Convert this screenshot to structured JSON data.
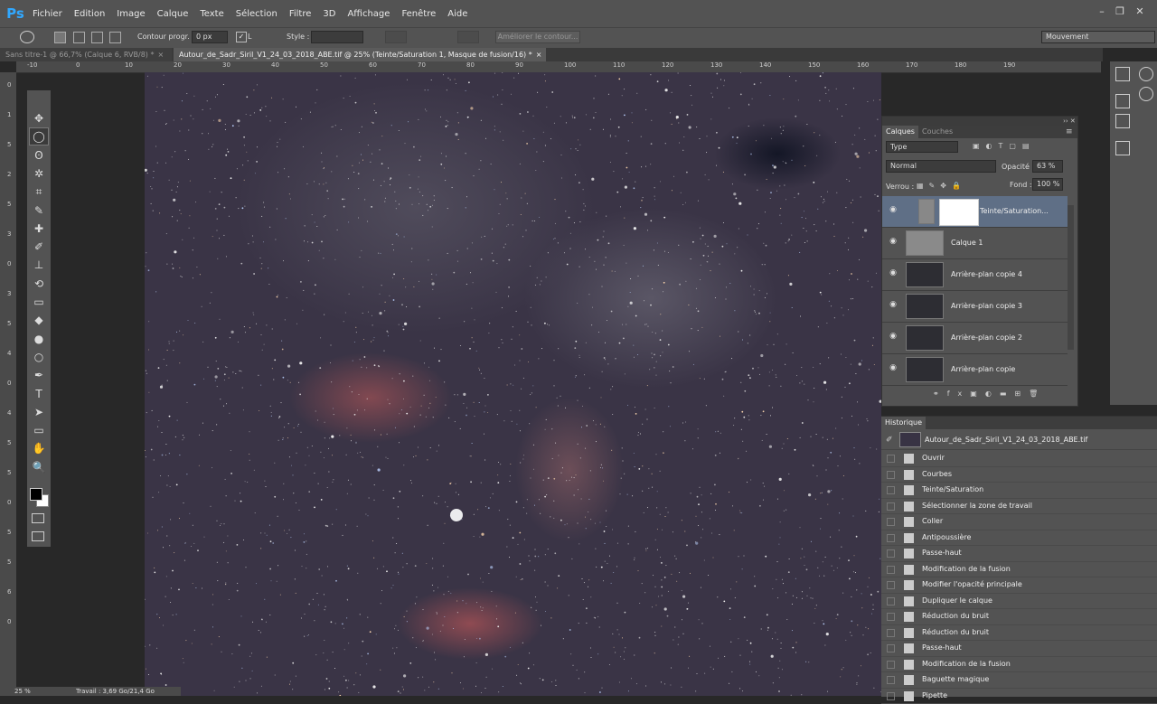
{
  "app": {
    "logo": "Ps"
  },
  "menu": [
    "Fichier",
    "Edition",
    "Image",
    "Calque",
    "Texte",
    "Sélection",
    "Filtre",
    "3D",
    "Affichage",
    "Fenêtre",
    "Aide"
  ],
  "window_controls": [
    "–",
    "❐",
    "✕"
  ],
  "options_bar": {
    "feather_label": "Contour progr. :",
    "feather_value": "0 px",
    "antialias_label": "L",
    "style_label": "Style :",
    "refine_edge_button": "Améliorer le contour...",
    "workspace_value": "Mouvement"
  },
  "tabs": [
    {
      "label": "Sans titre-1 @ 66,7% (Calque 6, RVB/8) *",
      "close": "×"
    },
    {
      "label": "Autour_de_Sadr_Siril_V1_24_03_2018_ABE.tif @ 25% (Teinte/Saturation 1, Masque de fusion/16) *",
      "close": "×"
    }
  ],
  "ruler_h": [
    "-10",
    "0",
    "10",
    "20",
    "30",
    "40",
    "50",
    "60",
    "70",
    "80",
    "90",
    "100",
    "110",
    "120",
    "130",
    "140",
    "150",
    "160",
    "170",
    "180",
    "190"
  ],
  "ruler_v": [
    "0",
    "1",
    "5",
    "2",
    "5",
    "3",
    "0",
    "3",
    "5",
    "4",
    "0",
    "4",
    "5",
    "5",
    "0",
    "5",
    "5",
    "6",
    "0"
  ],
  "toolbox": {
    "tools": [
      "move-tool-icon",
      "elliptical-marquee-icon",
      "lasso-icon",
      "magic-wand-icon",
      "crop-icon",
      "eyedropper-icon",
      "healing-brush-icon",
      "brush-icon",
      "clone-stamp-icon",
      "history-brush-icon",
      "eraser-icon",
      "paint-bucket-icon",
      "blur-icon",
      "dodge-icon",
      "pen-icon",
      "type-icon",
      "path-selection-icon",
      "rectangle-icon",
      "hand-icon",
      "zoom-icon"
    ],
    "glyphs": [
      "✥",
      "◯",
      "ʘ",
      "✲",
      "⌗",
      "✎",
      "✚",
      "✐",
      "⊥",
      "⟲",
      "▭",
      "◆",
      "●",
      "○",
      "✒",
      "T",
      "➤",
      "▭",
      "✋",
      "🔍"
    ]
  },
  "layers_panel": {
    "tabs": [
      "Calques",
      "Couches"
    ],
    "filter_kind": "Type",
    "blend_mode": "Normal",
    "opacity_label": "Opacité :",
    "opacity_value": "63 %",
    "lock_label": "Verrou :",
    "fill_label": "Fond :",
    "fill_value": "100 %",
    "layers": [
      {
        "name": "Teinte/Saturation...",
        "selected": true
      },
      {
        "name": "Calque 1",
        "selected": false
      },
      {
        "name": "Arrière-plan copie 4",
        "selected": false
      },
      {
        "name": "Arrière-plan copie 3",
        "selected": false
      },
      {
        "name": "Arrière-plan copie 2",
        "selected": false
      },
      {
        "name": "Arrière-plan copie",
        "selected": false
      }
    ],
    "footer_icons": [
      "link-icon",
      "fx-icon",
      "mask-icon",
      "adjustment-icon",
      "group-icon",
      "new-layer-icon",
      "trash-icon"
    ]
  },
  "history_panel": {
    "title": "Historique",
    "snapshot": "Autour_de_Sadr_Siril_V1_24_03_2018_ABE.tif",
    "steps": [
      "Ouvrir",
      "Courbes",
      "Teinte/Saturation",
      "Sélectionner la zone de travail",
      "Coller",
      "Antipoussière",
      "Passe-haut",
      "Modification de la fusion",
      "Modifier l'opacité principale",
      "Dupliquer le calque",
      "Réduction du bruit",
      "Réduction du bruit",
      "Passe-haut",
      "Modification de la fusion",
      "Baguette magique",
      "Pipette"
    ]
  },
  "status": {
    "zoom": "25 %",
    "doc_info": "Travail : 3,69 Go/21,4 Go"
  }
}
